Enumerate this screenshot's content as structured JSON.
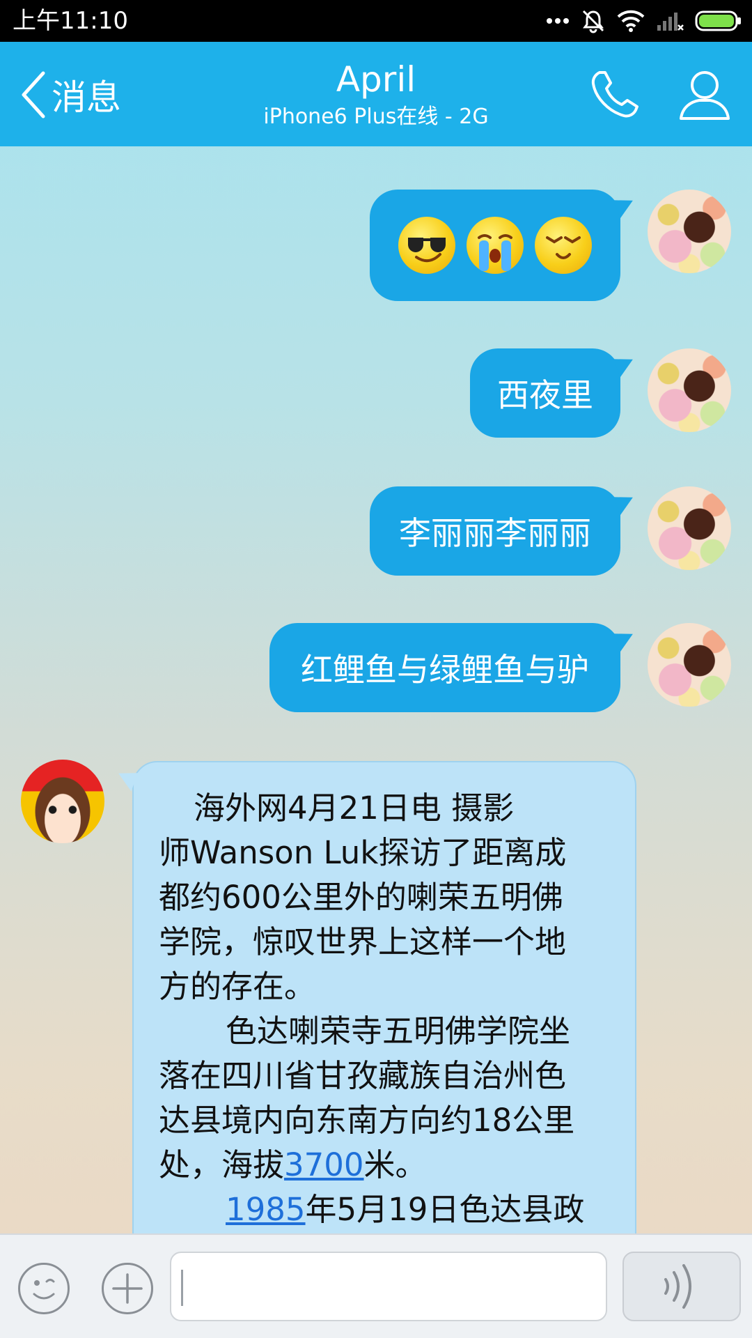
{
  "status_bar": {
    "time": "上午11:10",
    "icons": [
      "more-dots-icon",
      "muted-bell-icon",
      "wifi-icon",
      "cellular-no-signal-icon",
      "battery-full-icon"
    ],
    "battery_color": "#7ee04a"
  },
  "header": {
    "back_label": "消息",
    "contact_name": "April",
    "contact_status": "iPhone6 Plus在线 - 2G",
    "background": "#1eb1ea"
  },
  "messages": [
    {
      "direction": "outgoing",
      "type": "emoji",
      "emojis": [
        "sunglasses-smile-emoji",
        "crying-emoji",
        "squinting-smile-emoji"
      ]
    },
    {
      "direction": "outgoing",
      "type": "text",
      "text": "西夜里"
    },
    {
      "direction": "outgoing",
      "type": "text",
      "text": "李丽丽李丽丽"
    },
    {
      "direction": "outgoing",
      "type": "text",
      "text": "红鲤鱼与绿鲤鱼与驴"
    },
    {
      "direction": "incoming",
      "type": "text",
      "lines": [
        "海外网4月21日电 摄影",
        "师Wanson Luk探访了距离成",
        "都约600公里外的喇荣五明佛",
        "学院，惊叹世界上这样一个地",
        "方的存在。",
        "色达喇荣寺五明佛学院坐",
        "落在四川省甘孜藏族自治州色",
        "达县境内向东南方向约18公里"
      ],
      "line9_prefix": "处，海拔",
      "line9_link": "3700",
      "line9_suffix": "米。",
      "line10_link": "1985",
      "line10_suffix": "年5月19日色达县政"
    }
  ],
  "bottom_bar": {
    "emoji_button": "emoji-face-icon",
    "add_button": "plus-icon",
    "input_value": "",
    "voice_button": "voice-wave-icon"
  },
  "colors": {
    "outgoing_bubble": "#1aa6e6",
    "incoming_bubble": "#bde3f8",
    "link": "#1e6fd9"
  }
}
